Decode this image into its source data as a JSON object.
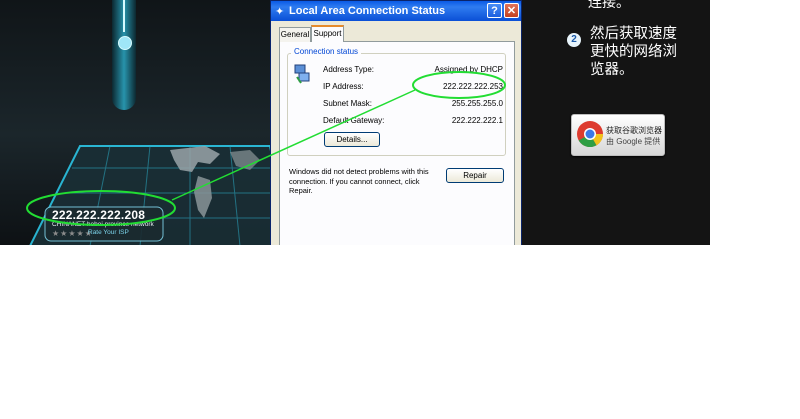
{
  "speedtest": {
    "ip": "222.222.222.208",
    "isp": "CHINANET hebei province network",
    "rate_label": "Rate Your ISP",
    "stars": "★★★★★"
  },
  "dialog": {
    "title": "Local Area Connection Status",
    "help_label": "?",
    "close_label": "✕",
    "tabs": [
      "General",
      "Support"
    ],
    "group_title": "Connection status",
    "rows": [
      {
        "label": "Address Type:",
        "value": "Assigned by DHCP"
      },
      {
        "label": "IP Address:",
        "value": "222.222.222.253"
      },
      {
        "label": "Subnet Mask:",
        "value": "255.255.255.0"
      },
      {
        "label": "Default Gateway:",
        "value": "222.222.222.1"
      }
    ],
    "details_label": "Details...",
    "message": "Windows did not detect problems with this connection. If you cannot connect, click Repair.",
    "repair_label": "Repair"
  },
  "promo": {
    "top_text": "连接。",
    "step_number": "2",
    "step_text": "然后获取速度更快的网络浏览器。",
    "chrome_line1": "获取谷歌浏览器",
    "chrome_line2": "由 Google 提供"
  },
  "colors": {
    "highlight": "#22dd33",
    "xp_title": "#0a5ae6",
    "tab_accent": "#e68b2c",
    "group_title": "#0046d5"
  },
  "icons": [
    "network-adapter-icon",
    "network-tray-icon",
    "chrome-icon"
  ]
}
